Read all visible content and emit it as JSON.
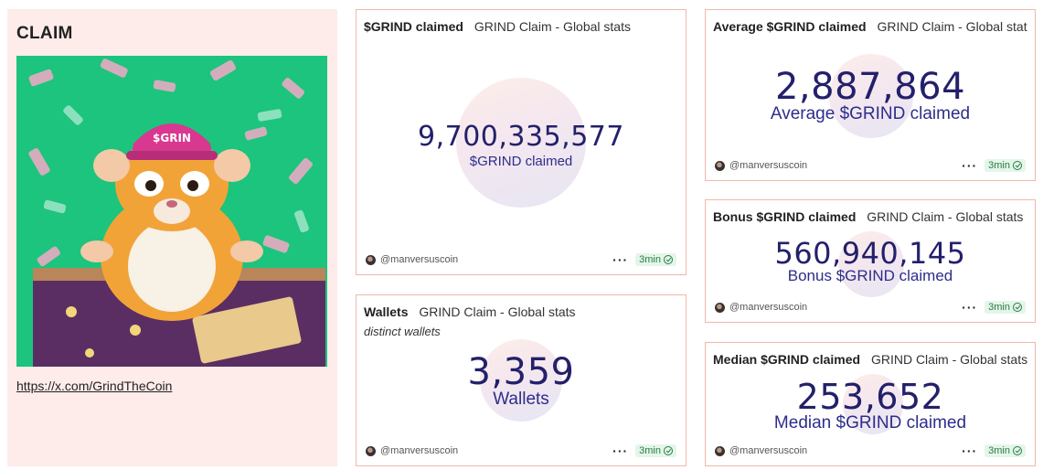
{
  "claim": {
    "title": "CLAIM",
    "link": "https://x.com/GrindTheCoin",
    "image_alt": "Animated hamster wearing a $GRIND cap throwing money"
  },
  "cards": {
    "claimed": {
      "title": "$GRIND claimed",
      "subtitle": "GRIND Claim - Global stats",
      "value": "9,700,335,577",
      "label": "$GRIND claimed",
      "author": "@manversuscoin",
      "age": "3min"
    },
    "wallets": {
      "title": "Wallets",
      "subtitle": "GRIND Claim - Global stats",
      "description": "distinct wallets",
      "value": "3,359",
      "label": "Wallets",
      "author": "@manversuscoin",
      "age": "3min"
    },
    "average": {
      "title": "Average $GRIND claimed",
      "subtitle": "GRIND Claim - Global stats",
      "value": "2,887,864",
      "label": "Average $GRIND claimed",
      "author": "@manversuscoin",
      "age": "3min"
    },
    "bonus": {
      "title": "Bonus $GRIND claimed",
      "subtitle": "GRIND Claim - Global stats",
      "value": "560,940,145",
      "label": "Bonus $GRIND claimed",
      "author": "@manversuscoin",
      "age": "3min"
    },
    "median": {
      "title": "Median $GRIND claimed",
      "subtitle": "GRIND Claim - Global stats",
      "value": "253,652",
      "label": "Median $GRIND claimed",
      "author": "@manversuscoin",
      "age": "3min"
    }
  },
  "colors": {
    "panel_bg": "#fdecea",
    "card_border": "#f0b8a8",
    "counter_text": "#23206b",
    "badge_bg": "#e3f6e9",
    "badge_text": "#2c7a45"
  }
}
